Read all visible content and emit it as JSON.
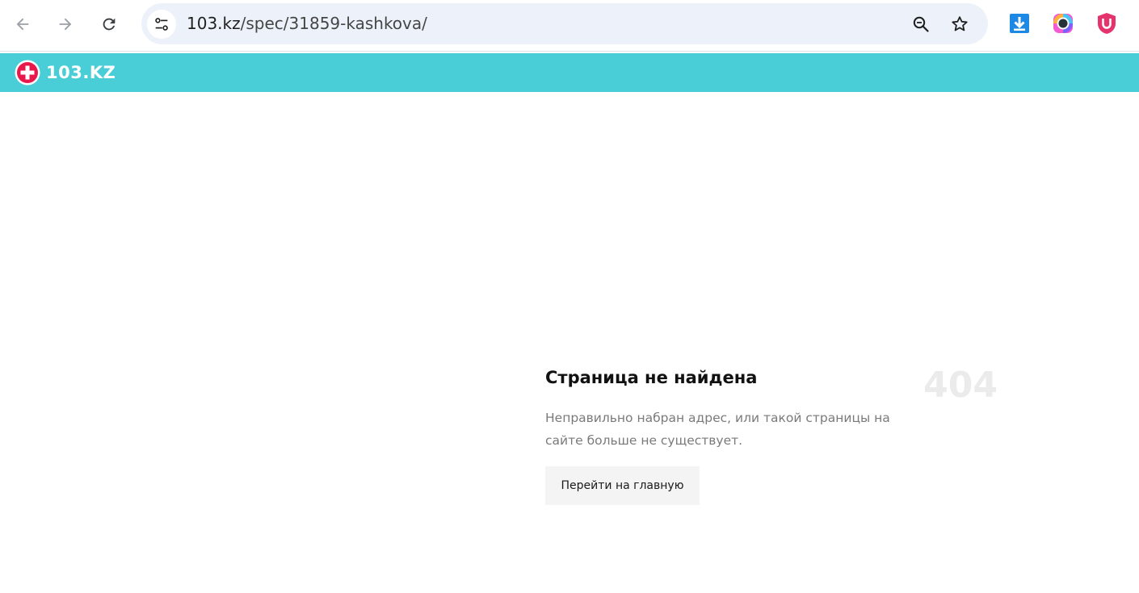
{
  "browser": {
    "url_host": "103.kz",
    "url_path": "/spec/31859-kashkova/",
    "icons": {
      "back": "arrow-left-icon",
      "forward": "arrow-right-icon",
      "reload": "reload-icon",
      "site_info": "tune-icon",
      "zoom": "zoom-out-icon",
      "bookmark": "star-icon"
    },
    "extensions": [
      "download-extension-icon",
      "color-picker-extension-icon",
      "shield-u-extension-icon"
    ]
  },
  "site": {
    "logo_text": "103.KZ",
    "header_color": "#49ced8",
    "logo_accent": "#e8194a"
  },
  "error": {
    "title": "Страница не найдена",
    "code": "404",
    "message": "Неправильно набран адрес, или такой страницы на сайте больше не существует.",
    "button_label": "Перейти на главную"
  }
}
